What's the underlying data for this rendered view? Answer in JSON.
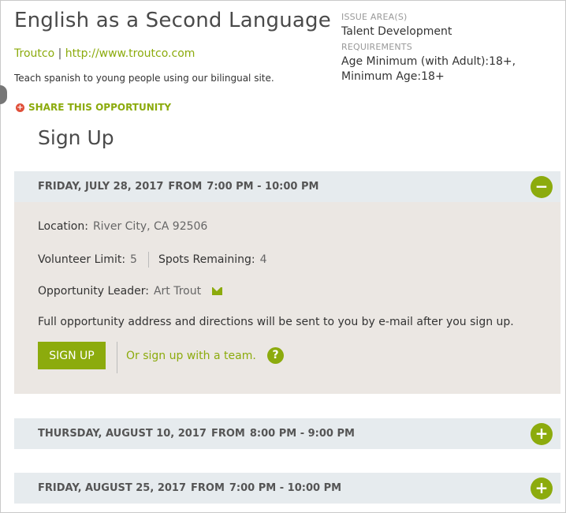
{
  "opportunity": {
    "title": "English as a Second Language",
    "org_name": "Troutco",
    "org_sep": "|",
    "org_url": "http://www.troutco.com",
    "description": "Teach spanish to young people using our bilingual site.",
    "share_label": "SHARE THIS OPPORTUNITY"
  },
  "meta": {
    "issue_label": "ISSUE AREA(S)",
    "issue_value": "Talent Development",
    "req_label": "REQUIREMENTS",
    "req_value": "Age Minimum (with Adult):18+, Minimum Age:18+"
  },
  "signup": {
    "heading": "Sign Up",
    "sessions": [
      {
        "date": "FRIDAY, JULY 28, 2017",
        "from": "FROM",
        "time": "7:00 PM - 10:00 PM",
        "expanded": true,
        "toggle": "−"
      },
      {
        "date": "THURSDAY, AUGUST 10, 2017",
        "from": "FROM",
        "time": "8:00 PM - 9:00 PM",
        "expanded": false,
        "toggle": "+"
      },
      {
        "date": "FRIDAY, AUGUST 25, 2017",
        "from": "FROM",
        "time": "7:00 PM - 10:00 PM",
        "expanded": false,
        "toggle": "+"
      }
    ],
    "details": {
      "location_label": "Location:",
      "location_value": "River City, CA 92506",
      "limit_label": "Volunteer Limit:",
      "limit_value": "5",
      "spots_label": "Spots Remaining:",
      "spots_value": "4",
      "leader_label": "Opportunity Leader:",
      "leader_value": "Art Trout",
      "note": "Full opportunity address and directions will be sent to you by e-mail after you sign up.",
      "signup_button": "SIGN UP",
      "team_link": "Or sign up with a team.",
      "help": "?"
    }
  },
  "colors": {
    "accent": "#8cab0d",
    "share_icon": "#e0503a",
    "header_bg": "#e6ebee",
    "body_bg": "#ebe7e3"
  }
}
